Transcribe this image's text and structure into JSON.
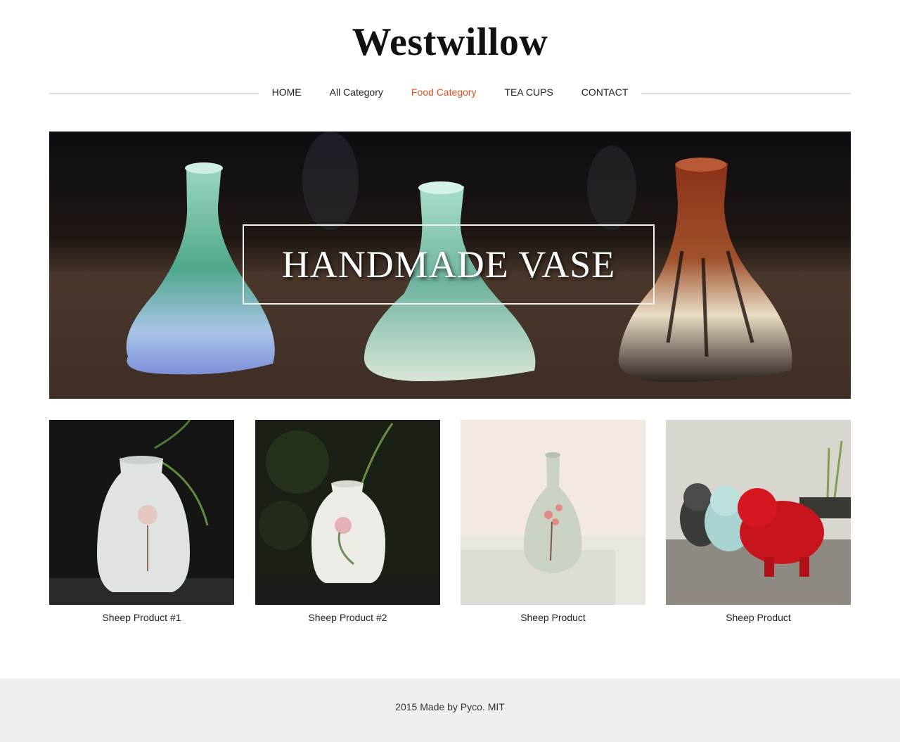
{
  "site": {
    "title": "Westwillow"
  },
  "nav": {
    "items": [
      {
        "label": "HOME"
      },
      {
        "label": "All Category"
      },
      {
        "label": "Food Category"
      },
      {
        "label": "TEA CUPS"
      },
      {
        "label": "CONTACT"
      }
    ],
    "active_item": "Food Category",
    "active_color": "#e0501e"
  },
  "hero": {
    "caption": "HANDMADE VASE"
  },
  "products": [
    {
      "name": "Sheep Product #1"
    },
    {
      "name": "Sheep Product #2"
    },
    {
      "name": "Sheep Product"
    },
    {
      "name": "Sheep Product"
    }
  ],
  "footer": {
    "text": "2015 Made by Pyco. MIT"
  }
}
